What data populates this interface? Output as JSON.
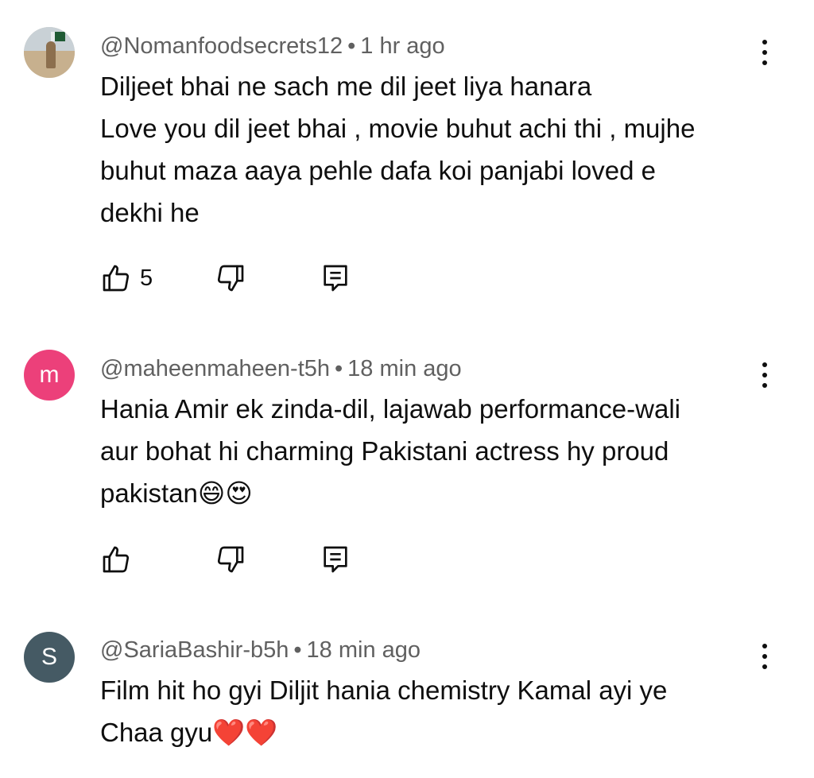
{
  "comments": [
    {
      "author": "@Nomanfoodsecrets12",
      "separator": "•",
      "time": "1 hr ago",
      "lines": [
        "Diljeet bhai ne sach me dil jeet liya hanara",
        "Love you dil jeet bhai , movie buhut achi thi , mujhe",
        "buhut maza aaya pehle dafa koi panjabi loved e",
        "dekhi he"
      ],
      "likes": "5",
      "avatar": {
        "type": "photo"
      }
    },
    {
      "author": "@maheenmaheen-t5h",
      "separator": "•",
      "time": "18 min ago",
      "lines": [
        "Hania Amir ek zinda-dil, lajawab performance-wali",
        "aur bohat hi charming Pakistani actress hy  proud",
        "pakistan😄😍"
      ],
      "likes": "",
      "avatar": {
        "type": "letter",
        "letter": "m",
        "color": "#ec407a"
      }
    },
    {
      "author": "@SariaBashir-b5h",
      "separator": "•",
      "time": "18 min ago",
      "lines": [
        "Film hit ho gyi Diljit hania chemistry Kamal ayi ye",
        "Chaa gyu❤️❤️"
      ],
      "avatar": {
        "type": "letter",
        "letter": "S",
        "color": "#455a64"
      }
    }
  ],
  "icons": {
    "like": "thumbs-up-icon",
    "dislike": "thumbs-down-icon",
    "reply": "reply-comment-icon",
    "more": "more-vertical-icon"
  },
  "colors": {
    "text": "#0f0f0f",
    "secondary": "#606060",
    "background": "#ffffff"
  }
}
